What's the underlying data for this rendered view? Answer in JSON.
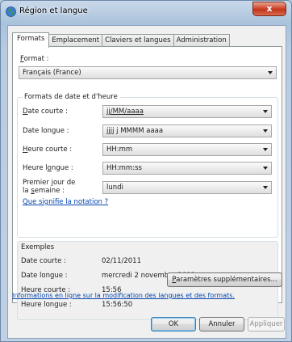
{
  "window": {
    "title": "Région et langue",
    "close_label": "x"
  },
  "tabs": [
    {
      "label": "Formats",
      "active": true
    },
    {
      "label": "Emplacement",
      "active": false
    },
    {
      "label": "Claviers et langues",
      "active": false
    },
    {
      "label": "Administration",
      "active": false
    }
  ],
  "format": {
    "label_underlined": "F",
    "label_rest": "ormat :",
    "value": "Français (France)"
  },
  "datetime_group": {
    "title": "Formats de date et d'heure",
    "fields": [
      {
        "label_pre": "",
        "label_u": "D",
        "label_post": "ate courte :",
        "value": "jj/MM/aaaa"
      },
      {
        "label_pre": "Date longue :",
        "label_u": "",
        "label_post": "",
        "value": "jjjj j MMMM aaaa"
      },
      {
        "label_pre": "",
        "label_u": "H",
        "label_post": "eure courte :",
        "value": "HH:mm"
      },
      {
        "label_pre": "Heure l",
        "label_u": "o",
        "label_post": "ngue :",
        "value": "HH:mm:ss"
      },
      {
        "label_pre": "Premier jour de",
        "label_line2_pre": "la ",
        "label_u": "s",
        "label_post": "emaine :",
        "value": "lundi"
      }
    ],
    "help_link": "Que signifie la notation ?"
  },
  "examples": {
    "title": "Exemples",
    "rows": [
      {
        "label": "Date courte :",
        "value": "02/11/2011"
      },
      {
        "label": "Date longue :",
        "value": "mercredi 2 novembre 2011"
      },
      {
        "label": "Heure courte :",
        "value": "15:56"
      },
      {
        "label": "Heure longue :",
        "value": "15:56:50"
      }
    ]
  },
  "more_settings_label_u": "P",
  "more_settings_label_rest": "aramètres supplémentaires...",
  "online_info_link": "Informations en ligne sur la modification des langues et des formats.",
  "buttons": {
    "ok": "OK",
    "cancel": "Annuler",
    "apply": "Appliquer"
  },
  "colors": {
    "link": "#0645ad",
    "close": "#c1341b",
    "chrome": "#b7cbe1"
  }
}
